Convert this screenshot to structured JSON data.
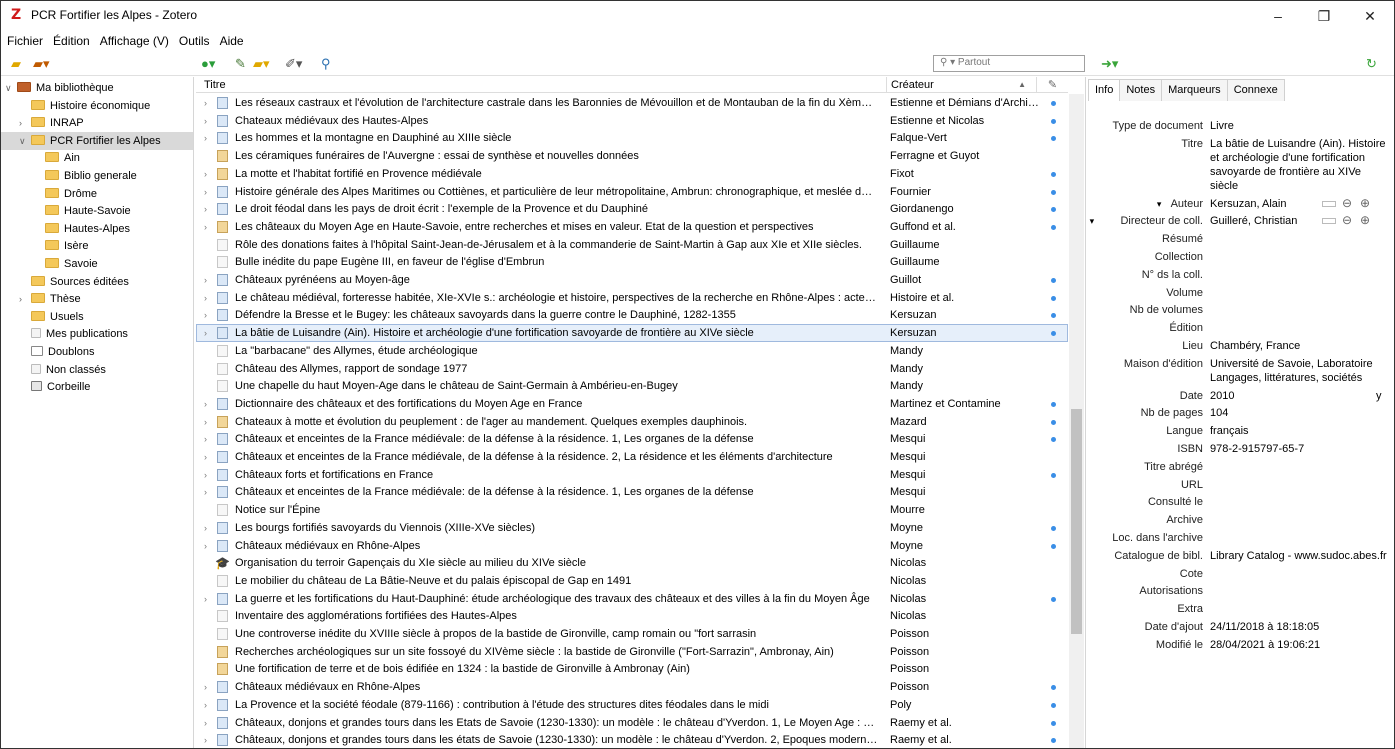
{
  "window": {
    "title": "PCR Fortifier les Alpes - Zotero",
    "logo": "Z"
  },
  "menu": [
    "Fichier",
    "Édition",
    "Affichage (V)",
    "Outils",
    "Aide"
  ],
  "search": {
    "placeholder": "Partout"
  },
  "collections": [
    {
      "label": "Ma bibliothèque",
      "indent": 0,
      "twisty": "∨",
      "type": "library"
    },
    {
      "label": "Histoire économique",
      "indent": 1,
      "twisty": "",
      "type": "folder"
    },
    {
      "label": "INRAP",
      "indent": 1,
      "twisty": "›",
      "type": "folder"
    },
    {
      "label": "PCR Fortifier les Alpes",
      "indent": 1,
      "twisty": "∨",
      "type": "folder",
      "selected": true
    },
    {
      "label": "Ain",
      "indent": 2,
      "twisty": "",
      "type": "folder"
    },
    {
      "label": "Biblio generale",
      "indent": 2,
      "twisty": "",
      "type": "folder"
    },
    {
      "label": "Drôme",
      "indent": 2,
      "twisty": "",
      "type": "folder"
    },
    {
      "label": "Haute-Savoie",
      "indent": 2,
      "twisty": "",
      "type": "folder"
    },
    {
      "label": "Hautes-Alpes",
      "indent": 2,
      "twisty": "",
      "type": "folder"
    },
    {
      "label": "Isère",
      "indent": 2,
      "twisty": "",
      "type": "folder"
    },
    {
      "label": "Savoie",
      "indent": 2,
      "twisty": "",
      "type": "folder"
    },
    {
      "label": "Sources éditées",
      "indent": 1,
      "twisty": "",
      "type": "folder"
    },
    {
      "label": "Thèse",
      "indent": 1,
      "twisty": "›",
      "type": "folder"
    },
    {
      "label": "Usuels",
      "indent": 1,
      "twisty": "",
      "type": "folder"
    },
    {
      "label": "Mes publications",
      "indent": 1,
      "twisty": "",
      "type": "doc"
    },
    {
      "label": "Doublons",
      "indent": 1,
      "twisty": "",
      "type": "dup"
    },
    {
      "label": "Non classés",
      "indent": 1,
      "twisty": "",
      "type": "doc"
    },
    {
      "label": "Corbeille",
      "indent": 1,
      "twisty": "",
      "type": "trash"
    }
  ],
  "columns": {
    "title": "Titre",
    "creator": "Créateur"
  },
  "items": [
    {
      "t": "Les réseaux castraux et l'évolution de l'architecture castrale dans les Baronnies de Mévouillon et de Montauban de la fin du Xème siècl...",
      "c": "Estienne et Démians d'Archim...",
      "arrow": true,
      "icon": "book",
      "att": true
    },
    {
      "t": "Chateaux médiévaux des Hautes-Alpes",
      "c": "Estienne et Nicolas",
      "arrow": true,
      "icon": "book",
      "att": true
    },
    {
      "t": "Les hommes et la montagne en Dauphiné au XIIIe siècle",
      "c": "Falque-Vert",
      "arrow": true,
      "icon": "book",
      "att": true
    },
    {
      "t": "Les céramiques funéraires de l'Auvergne : essai de synthèse et nouvelles données",
      "c": "Ferragne et Guyot",
      "arrow": false,
      "icon": "part",
      "att": false
    },
    {
      "t": "La motte et l'habitat fortifié en Provence médiévale",
      "c": "Fixot",
      "arrow": true,
      "icon": "part",
      "att": true
    },
    {
      "t": "Histoire générale des Alpes Maritimes ou Cottiènes, et particulière de leur métropolitaine, Ambrun: chronographique, et meslée de la s...",
      "c": "Fournier",
      "arrow": true,
      "icon": "book",
      "att": true
    },
    {
      "t": "Le droit féodal dans les pays de droit écrit : l'exemple de la Provence et du Dauphiné",
      "c": "Giordanengo",
      "arrow": true,
      "icon": "book",
      "att": true
    },
    {
      "t": "Les châteaux du Moyen Age en Haute-Savoie, entre recherches et mises en valeur. Etat de la question et perspectives",
      "c": "Guffond et al.",
      "arrow": true,
      "icon": "part",
      "att": true
    },
    {
      "t": "Rôle des donations faites à l'hôpital Saint-Jean-de-Jérusalem et à la commanderie de Saint-Martin à Gap aux XIe et XIIe siècles.",
      "c": "Guillaume",
      "arrow": false,
      "icon": "doc",
      "att": false
    },
    {
      "t": "Bulle inédite du pape Eugène III, en faveur de l'église d'Embrun",
      "c": "Guillaume",
      "arrow": false,
      "icon": "doc",
      "att": false
    },
    {
      "t": "Châteaux pyrénéens au Moyen-âge",
      "c": "Guillot",
      "arrow": true,
      "icon": "book",
      "att": true
    },
    {
      "t": "Le château médiéval, forteresse habitée, XIe-XVIe s.: archéologie et histoire, perspectives de la recherche en Rhône-Alpes : actes du col...",
      "c": "Histoire et al.",
      "arrow": true,
      "icon": "book",
      "att": true
    },
    {
      "t": "Défendre la Bresse et le Bugey: les châteaux savoyards dans la guerre contre le Dauphiné, 1282-1355",
      "c": "Kersuzan",
      "arrow": true,
      "icon": "book",
      "att": true
    },
    {
      "t": "La bâtie de Luisandre (Ain). Histoire et archéologie d'une fortification savoyarde de frontière au XIVe siècle",
      "c": "Kersuzan",
      "arrow": true,
      "icon": "book",
      "att": true,
      "selected": true
    },
    {
      "t": "La \"barbacane\" des Allymes, étude archéologique",
      "c": "Mandy",
      "arrow": false,
      "icon": "doc",
      "att": false
    },
    {
      "t": "Château des Allymes, rapport de sondage 1977",
      "c": "Mandy",
      "arrow": false,
      "icon": "doc",
      "att": false
    },
    {
      "t": "Une chapelle du haut Moyen-Age dans le château de Saint-Germain à Ambérieu-en-Bugey",
      "c": "Mandy",
      "arrow": false,
      "icon": "doc",
      "att": false
    },
    {
      "t": "Dictionnaire des châteaux et des fortifications du Moyen Age en France",
      "c": "Martinez et Contamine",
      "arrow": true,
      "icon": "book",
      "att": true
    },
    {
      "t": "Chateaux à motte et évolution du peuplement : de l'ager au mandement. Quelques exemples dauphinois.",
      "c": "Mazard",
      "arrow": true,
      "icon": "part",
      "att": true
    },
    {
      "t": "Châteaux et enceintes de la France médiévale: de la défense à la résidence. 1, Les organes de la défense",
      "c": "Mesqui",
      "arrow": true,
      "icon": "book",
      "att": true
    },
    {
      "t": "Châteaux et enceintes de la France médiévale, de la défense à la résidence. 2, La résidence et les éléments d'architecture",
      "c": "Mesqui",
      "arrow": true,
      "icon": "book",
      "att": false
    },
    {
      "t": "Châteaux forts et fortifications en France",
      "c": "Mesqui",
      "arrow": true,
      "icon": "book",
      "att": true
    },
    {
      "t": "Châteaux et enceintes de la France médiévale: de la défense à la résidence. 1, Les organes de la défense",
      "c": "Mesqui",
      "arrow": true,
      "icon": "book",
      "att": false
    },
    {
      "t": "Notice sur l'Épine",
      "c": "Mourre",
      "arrow": false,
      "icon": "doc",
      "att": false
    },
    {
      "t": "Les bourgs fortifiés savoyards du Viennois (XIIIe-XVe siècles)",
      "c": "Moyne",
      "arrow": true,
      "icon": "book",
      "att": true
    },
    {
      "t": "Châteaux médiévaux en Rhône-Alpes",
      "c": "Moyne",
      "arrow": true,
      "icon": "book",
      "att": true
    },
    {
      "t": "Organisation du terroir Gapençais du XIe siècle au milieu du XIVe siècle",
      "c": "Nicolas",
      "arrow": false,
      "icon": "thesis",
      "att": false
    },
    {
      "t": "Le mobilier du château de La Bâtie-Neuve et du palais épiscopal de Gap en 1491",
      "c": "Nicolas",
      "arrow": false,
      "icon": "doc",
      "att": false
    },
    {
      "t": "La guerre et les fortifications du Haut-Dauphiné: étude archéologique des travaux des châteaux et des villes à la fin du Moyen Âge",
      "c": "Nicolas",
      "arrow": true,
      "icon": "book",
      "att": true
    },
    {
      "t": "Inventaire des agglomérations fortifiées des Hautes-Alpes",
      "c": "Nicolas",
      "arrow": false,
      "icon": "doc",
      "att": false
    },
    {
      "t": "Une controverse inédite du XVIIIe siècle à propos de la bastide de Gironville, camp romain ou \"fort sarrasin",
      "c": "Poisson",
      "arrow": false,
      "icon": "doc",
      "att": false
    },
    {
      "t": "Recherches archéologiques sur un site fossoyé du XIVème siècle : la bastide de Gironville (\"Fort-Sarrazin\", Ambronay, Ain)",
      "c": "Poisson",
      "arrow": false,
      "icon": "part",
      "att": false
    },
    {
      "t": "Une fortification de terre et de bois édifiée en 1324 : la bastide de Gironville à Ambronay (Ain)",
      "c": "Poisson",
      "arrow": false,
      "icon": "part",
      "att": false
    },
    {
      "t": "Châteaux médiévaux en Rhône-Alpes",
      "c": "Poisson",
      "arrow": true,
      "icon": "book",
      "att": true
    },
    {
      "t": "La Provence et la société féodale (879-1166) : contribution à l'étude des structures dites féodales dans le midi",
      "c": "Poly",
      "arrow": true,
      "icon": "book",
      "att": true
    },
    {
      "t": "Châteaux, donjons et grandes tours dans les Etats de Savoie (1230-1330): un modèle : le château d'Yverdon. 1, Le Moyen Age : genèse ...",
      "c": "Raemy et al.",
      "arrow": true,
      "icon": "book",
      "att": true
    },
    {
      "t": "Châteaux, donjons et grandes tours dans les états de Savoie (1230-1330): un modèle : le château d'Yverdon. 2, Epoques moderne et co...",
      "c": "Raemy et al.",
      "arrow": true,
      "icon": "book",
      "att": true
    }
  ],
  "tabs": [
    "Info",
    "Notes",
    "Marqueurs",
    "Connexe"
  ],
  "info": [
    {
      "l": "Type de document",
      "v": "Livre",
      "lines": 1
    },
    {
      "l": "Titre",
      "v": "La bâtie de Luisandre (Ain). Histoire et archéologie d'une fortification savoyarde de frontière au XIVe siècle",
      "lines": 4
    },
    {
      "l": "Auteur",
      "v": "Kersuzan, Alain",
      "lines": 1,
      "twisty": true
    },
    {
      "l": "Directeur de coll.",
      "v": "Guilleré, Christian",
      "lines": 1,
      "twisty": true
    },
    {
      "l": "Résumé",
      "v": "",
      "lines": 1
    },
    {
      "l": "Collection",
      "v": "",
      "lines": 1
    },
    {
      "l": "N° ds la coll.",
      "v": "",
      "lines": 1
    },
    {
      "l": "Volume",
      "v": "",
      "lines": 1
    },
    {
      "l": "Nb de volumes",
      "v": "",
      "lines": 1
    },
    {
      "l": "Édition",
      "v": "",
      "lines": 1
    },
    {
      "l": "Lieu",
      "v": "Chambéry, France",
      "lines": 1
    },
    {
      "l": "Maison d'édition",
      "v": "Université de Savoie, Laboratoire Langages, littératures, sociétés",
      "lines": 2
    },
    {
      "l": "Date",
      "v": "2010",
      "lines": 1,
      "extra": "y"
    },
    {
      "l": "Nb de pages",
      "v": "104",
      "lines": 1
    },
    {
      "l": "Langue",
      "v": "français",
      "lines": 1
    },
    {
      "l": "ISBN",
      "v": "978-2-915797-65-7",
      "lines": 1
    },
    {
      "l": "Titre abrégé",
      "v": "",
      "lines": 1
    },
    {
      "l": "URL",
      "v": "",
      "lines": 1
    },
    {
      "l": "Consulté le",
      "v": "",
      "lines": 1
    },
    {
      "l": "Archive",
      "v": "",
      "lines": 1
    },
    {
      "l": "Loc. dans l'archive",
      "v": "",
      "lines": 1
    },
    {
      "l": "Catalogue de bibl.",
      "v": "Library Catalog - www.sudoc.abes.fr",
      "lines": 1
    },
    {
      "l": "Cote",
      "v": "",
      "lines": 1
    },
    {
      "l": "Autorisations",
      "v": "",
      "lines": 1
    },
    {
      "l": "Extra",
      "v": "",
      "lines": 1
    },
    {
      "l": "Date d'ajout",
      "v": "24/11/2018 à 18:18:05",
      "lines": 1
    },
    {
      "l": "Modifié le",
      "v": "28/04/2021 à 19:06:21",
      "lines": 1
    }
  ]
}
